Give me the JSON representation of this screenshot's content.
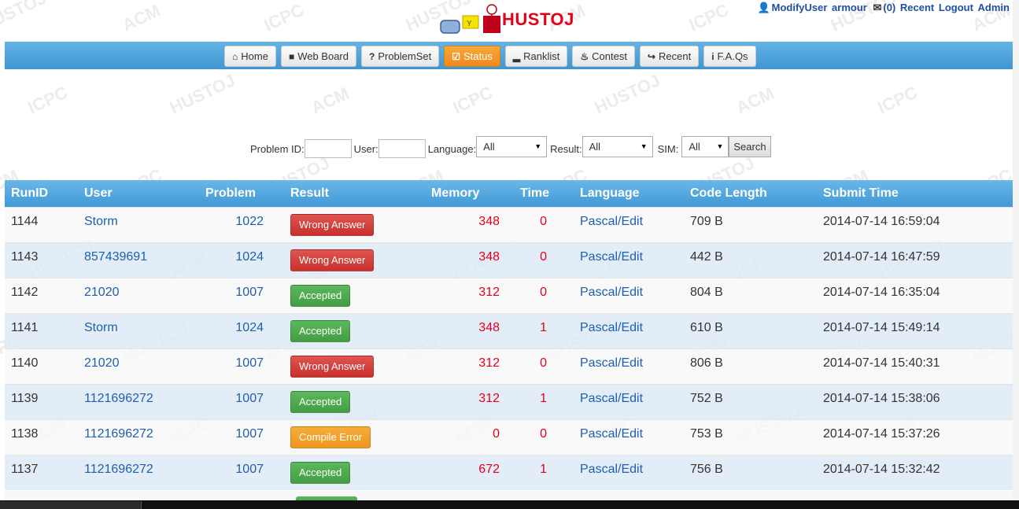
{
  "watermark": {
    "words": [
      "HUSTOJ",
      "ACM",
      "ICPC"
    ]
  },
  "top_links": {
    "modify_user": "ModifyUser",
    "username": "armour",
    "mail_count": "(0)",
    "recent": "Recent",
    "logout": "Logout",
    "admin": "Admin"
  },
  "logo": {
    "text": "HUSTOJ"
  },
  "nav": [
    {
      "icon": "home-icon",
      "glyph": "⌂",
      "label": "Home",
      "active": false
    },
    {
      "icon": "comment-icon",
      "glyph": "■",
      "label": "Web Board",
      "active": false
    },
    {
      "icon": "question-icon",
      "glyph": "?",
      "label": "ProblemSet",
      "active": false
    },
    {
      "icon": "check-icon",
      "glyph": "☑",
      "label": "Status",
      "active": true
    },
    {
      "icon": "signal-icon",
      "glyph": "▂",
      "label": "Ranklist",
      "active": false
    },
    {
      "icon": "fire-icon",
      "glyph": "♨",
      "label": "Contest",
      "active": false
    },
    {
      "icon": "share-icon",
      "glyph": "↪",
      "label": "Recent",
      "active": false
    },
    {
      "icon": "info-icon",
      "glyph": "i",
      "label": "F.A.Qs",
      "active": false
    }
  ],
  "filter": {
    "problem_id_label": "Problem ID:",
    "problem_id_value": "",
    "user_label": "User:",
    "user_value": "",
    "language_label": "Language:",
    "language_value": "All",
    "result_label": "Result:",
    "result_value": "All",
    "sim_label": "SIM:",
    "sim_value": "All",
    "search_label": "Search"
  },
  "table": {
    "headers": [
      "RunID",
      "User",
      "Problem",
      "Result",
      "Memory",
      "Time",
      "Language",
      "Code Length",
      "Submit Time"
    ],
    "rows": [
      {
        "runid": "1144",
        "user": "Storm",
        "problem": "1022",
        "result": "Wrong Answer",
        "result_type": "wa",
        "memory": "348",
        "time": "0",
        "language": "Pascal/Edit",
        "code_length": "709 B",
        "submit_time": "2014-07-14 16:59:04"
      },
      {
        "runid": "1143",
        "user": "857439691",
        "problem": "1024",
        "result": "Wrong Answer",
        "result_type": "wa",
        "memory": "348",
        "time": "0",
        "language": "Pascal/Edit",
        "code_length": "442 B",
        "submit_time": "2014-07-14 16:47:59"
      },
      {
        "runid": "1142",
        "user": "21020",
        "problem": "1007",
        "result": "Accepted",
        "result_type": "ac",
        "memory": "312",
        "time": "0",
        "language": "Pascal/Edit",
        "code_length": "804 B",
        "submit_time": "2014-07-14 16:35:04"
      },
      {
        "runid": "1141",
        "user": "Storm",
        "problem": "1024",
        "result": "Accepted",
        "result_type": "ac",
        "memory": "348",
        "time": "1",
        "language": "Pascal/Edit",
        "code_length": "610 B",
        "submit_time": "2014-07-14 15:49:14"
      },
      {
        "runid": "1140",
        "user": "21020",
        "problem": "1007",
        "result": "Wrong Answer",
        "result_type": "wa",
        "memory": "312",
        "time": "0",
        "language": "Pascal/Edit",
        "code_length": "806 B",
        "submit_time": "2014-07-14 15:40:31"
      },
      {
        "runid": "1139",
        "user": "1121696272",
        "problem": "1007",
        "result": "Accepted",
        "result_type": "ac",
        "memory": "312",
        "time": "1",
        "language": "Pascal/Edit",
        "code_length": "752 B",
        "submit_time": "2014-07-14 15:38:06"
      },
      {
        "runid": "1138",
        "user": "1121696272",
        "problem": "1007",
        "result": "Compile Error",
        "result_type": "ce",
        "memory": "0",
        "time": "0",
        "language": "Pascal/Edit",
        "code_length": "753 B",
        "submit_time": "2014-07-14 15:37:26"
      },
      {
        "runid": "1137",
        "user": "1121696272",
        "problem": "1007",
        "result": "Accepted",
        "result_type": "ac",
        "memory": "672",
        "time": "1",
        "language": "Pascal/Edit",
        "code_length": "756 B",
        "submit_time": "2014-07-14 15:32:42"
      }
    ]
  },
  "colors": {
    "nav_bar": "#4299d6",
    "active_tab": "#f0891e",
    "link": "#1e5fad",
    "value_red": "#e3001b",
    "wrong_answer": "#c9302c",
    "accepted": "#449d44",
    "compile_error": "#ec971f"
  }
}
